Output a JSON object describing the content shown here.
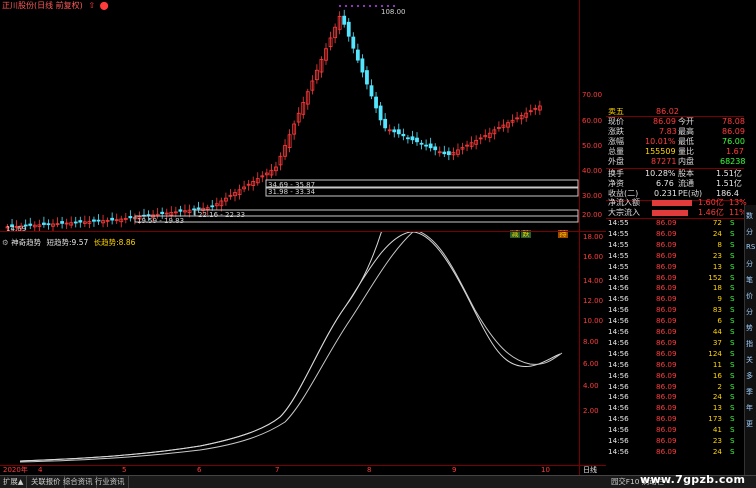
{
  "title": {
    "text": "正川股份(日线 前复权)"
  },
  "kline": {
    "peak_label": "108.00",
    "axis": [
      "70.00",
      "60.00",
      "50.00",
      "40.00",
      "30.00",
      "20.00"
    ],
    "annotations": [
      "14.69",
      "19.59 - 19.83",
      "22.16 - 22.33",
      "31.98 - 33.34",
      "34.69 - 35.87"
    ],
    "buttons": [
      "减",
      "跌",
      "持"
    ]
  },
  "indicator": {
    "name": "神奇趋势",
    "short_label": "短趋势:",
    "short_value": "9.57",
    "long_label": "长趋势:",
    "long_value": "8.86",
    "axis": [
      "18.00",
      "16.00",
      "14.00",
      "12.00",
      "10.00",
      "8.00",
      "6.00",
      "4.00",
      "2.00"
    ]
  },
  "date_axis": {
    "labels": [
      "2020年",
      "4",
      "5",
      "6",
      "7",
      "8",
      "9",
      "10"
    ],
    "period": "日线"
  },
  "quote": {
    "top_cut": "卖五",
    "rows": [
      {
        "l": "现价",
        "v1": "86.09",
        "m": "今开",
        "v2": "78.08"
      },
      {
        "l": "涨跌",
        "v1": "7.83",
        "m": "最高",
        "v2": "86.09"
      },
      {
        "l": "涨幅",
        "v1": "10.01%",
        "m": "最低",
        "v2": "76.00"
      },
      {
        "l": "总量",
        "v1": "155509",
        "m": "量比",
        "v2": "1.67"
      },
      {
        "l": "外盘",
        "v1": "87271",
        "m": "内盘",
        "v2": "68238"
      },
      {
        "l": "换手",
        "v1": "10.28%",
        "m": "股本",
        "v2": "1.51亿"
      },
      {
        "l": "净资",
        "v1": "6.76",
        "m": "流通",
        "v2": "1.51亿"
      },
      {
        "l": "收益(二)",
        "v1": "0.231",
        "m": "PE(动)",
        "v2": "186.4"
      }
    ],
    "flow": [
      {
        "label": "净流入额",
        "value": "1.60亿",
        "pct": "13%"
      },
      {
        "label": "大宗流入",
        "value": "1.46亿",
        "pct": "11%"
      }
    ]
  },
  "ticks": [
    {
      "t": "14:55",
      "p": "86.09",
      "v": "72",
      "s": "S"
    },
    {
      "t": "14:55",
      "p": "86.09",
      "v": "24",
      "s": "S"
    },
    {
      "t": "14:55",
      "p": "86.09",
      "v": "8",
      "s": "S"
    },
    {
      "t": "14:55",
      "p": "86.09",
      "v": "23",
      "s": "S"
    },
    {
      "t": "14:55",
      "p": "86.09",
      "v": "13",
      "s": "S"
    },
    {
      "t": "14:56",
      "p": "86.09",
      "v": "152",
      "s": "S"
    },
    {
      "t": "14:56",
      "p": "86.09",
      "v": "18",
      "s": "S"
    },
    {
      "t": "14:56",
      "p": "86.09",
      "v": "9",
      "s": "S"
    },
    {
      "t": "14:56",
      "p": "86.09",
      "v": "83",
      "s": "S"
    },
    {
      "t": "14:56",
      "p": "86.09",
      "v": "6",
      "s": "S"
    },
    {
      "t": "14:56",
      "p": "86.09",
      "v": "44",
      "s": "S"
    },
    {
      "t": "14:56",
      "p": "86.09",
      "v": "37",
      "s": "S"
    },
    {
      "t": "14:56",
      "p": "86.09",
      "v": "124",
      "s": "S"
    },
    {
      "t": "14:56",
      "p": "86.09",
      "v": "11",
      "s": "S"
    },
    {
      "t": "14:56",
      "p": "86.09",
      "v": "16",
      "s": "S"
    },
    {
      "t": "14:56",
      "p": "86.09",
      "v": "2",
      "s": "S"
    },
    {
      "t": "14:56",
      "p": "86.09",
      "v": "24",
      "s": "S"
    },
    {
      "t": "14:56",
      "p": "86.09",
      "v": "13",
      "s": "S"
    },
    {
      "t": "14:56",
      "p": "86.09",
      "v": "173",
      "s": "S"
    },
    {
      "t": "14:56",
      "p": "86.09",
      "v": "41",
      "s": "S"
    },
    {
      "t": "14:56",
      "p": "86.09",
      "v": "23",
      "s": "S"
    },
    {
      "t": "14:56",
      "p": "86.09",
      "v": "24",
      "s": "S"
    }
  ],
  "side_strip": [
    "数",
    "分",
    "RS",
    "分",
    "笔",
    "价",
    "分",
    "势",
    "指",
    "关",
    "多",
    "季",
    "年",
    "更"
  ],
  "bottom_tabs": [
    "扩展▲",
    "关联报价",
    "综合资讯",
    "行业资讯"
  ],
  "bottom_right": "园交F10 剩动栏 «",
  "watermark": "www.7gpzb.com",
  "colors": {
    "up": "#ff3b3b",
    "down": "#55e6ff",
    "panel_border": "#7a0000",
    "bg": "#000000"
  }
}
